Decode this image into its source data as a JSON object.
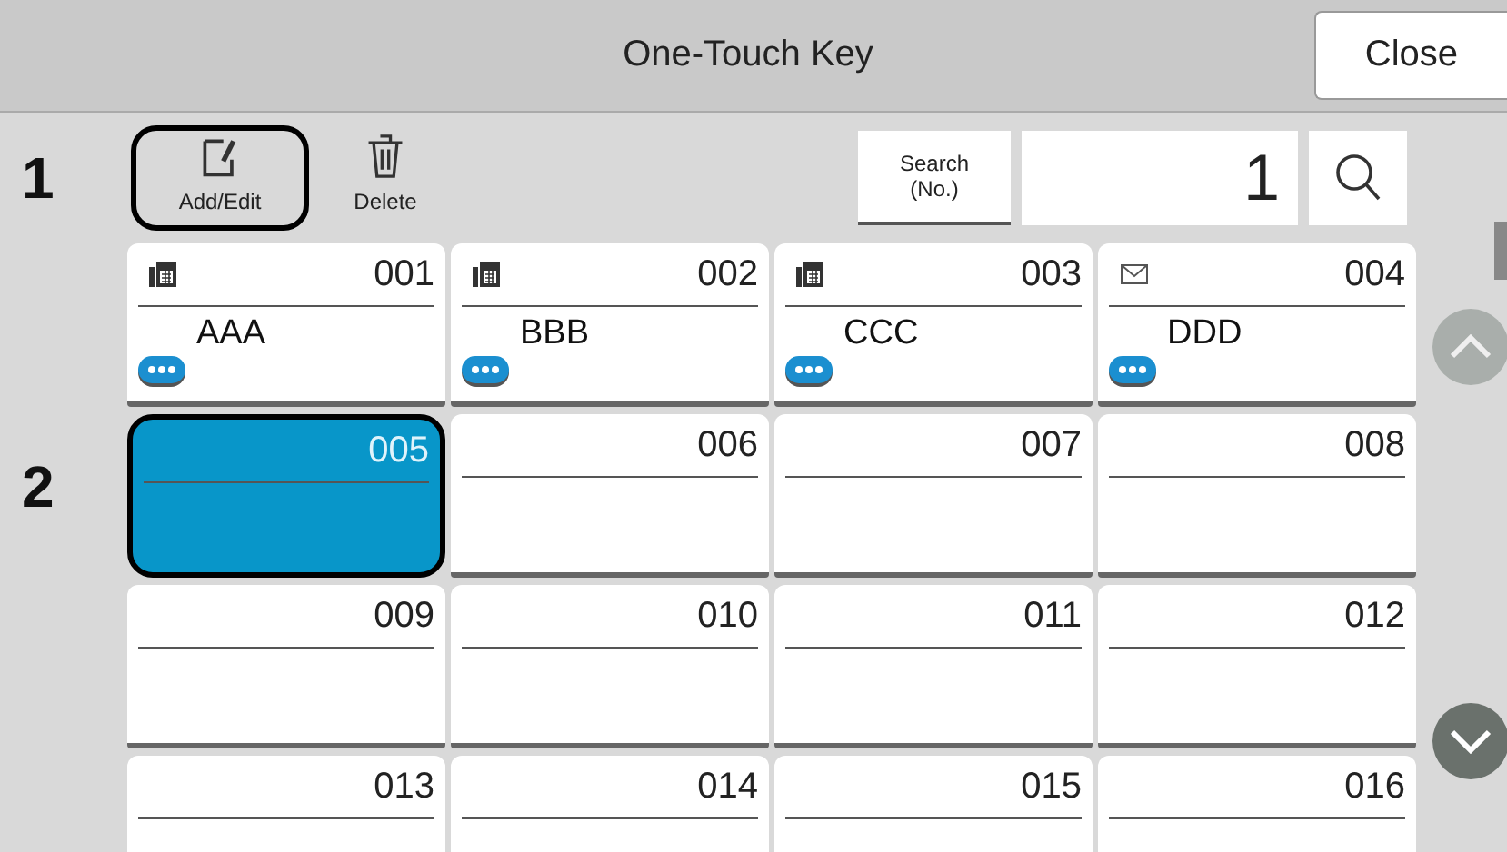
{
  "window": {
    "title": "One-Touch Key",
    "close_button": "Close"
  },
  "callouts": [
    {
      "label": "1"
    },
    {
      "label": "2"
    }
  ],
  "toolbar": [
    {
      "kind": "edit",
      "label": "Add/Edit",
      "outlined": true
    },
    {
      "kind": "delete",
      "label": "Delete",
      "outlined": false
    }
  ],
  "search": {
    "button": "Search\n(No.)",
    "value": "1"
  },
  "keys": [
    {
      "number": "001",
      "kind": "fax",
      "name": "AAA",
      "selected": false,
      "outlined": false
    },
    {
      "number": "002",
      "kind": "fax",
      "name": "BBB",
      "selected": false,
      "outlined": false
    },
    {
      "number": "003",
      "kind": "fax",
      "name": "CCC",
      "selected": false,
      "outlined": false
    },
    {
      "number": "004",
      "kind": "email",
      "name": "DDD",
      "selected": false,
      "outlined": false
    },
    {
      "number": "005",
      "kind": "empty",
      "selected": true,
      "outlined": true
    },
    {
      "number": "006",
      "kind": "empty",
      "selected": false,
      "outlined": false
    },
    {
      "number": "007",
      "kind": "empty",
      "selected": false,
      "outlined": false
    },
    {
      "number": "008",
      "kind": "empty",
      "selected": false,
      "outlined": false
    },
    {
      "number": "009",
      "kind": "empty",
      "selected": false,
      "outlined": false
    },
    {
      "number": "010",
      "kind": "empty",
      "selected": false,
      "outlined": false
    },
    {
      "number": "011",
      "kind": "empty",
      "selected": false,
      "outlined": false
    },
    {
      "number": "012",
      "kind": "empty",
      "selected": false,
      "outlined": false
    },
    {
      "number": "013",
      "kind": "empty",
      "selected": false,
      "outlined": false
    },
    {
      "number": "014",
      "kind": "empty",
      "selected": false,
      "outlined": false
    },
    {
      "number": "015",
      "kind": "empty",
      "selected": false,
      "outlined": false
    },
    {
      "number": "016",
      "kind": "empty",
      "selected": false,
      "outlined": false
    }
  ]
}
